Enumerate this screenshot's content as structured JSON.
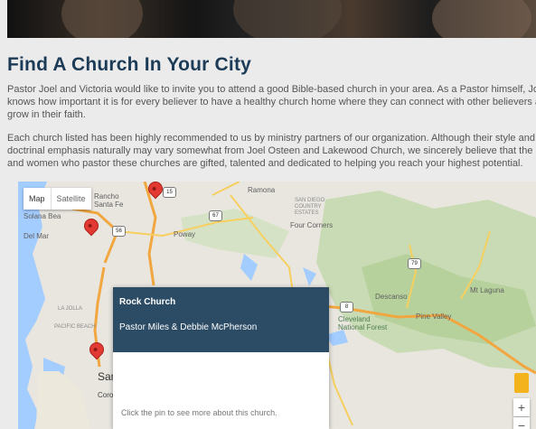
{
  "page": {
    "title": "Find A Church In Your City",
    "paragraph1_lines": [
      "Pastor Joel and Victoria would like to invite you to attend a good Bible-based church in your area. As a Pastor himself, Joel",
      "knows how important it is for every believer to have a healthy church home where they can connect with other believers and",
      "grow in their faith."
    ],
    "paragraph2_lines": [
      "Each church listed has been highly recommended to us by ministry partners of our organization. Although their style and",
      "doctrinal emphasis naturally may vary somewhat from Joel Osteen and Lakewood Church, we sincerely believe that the men",
      "and women who pastor these churches are gifted, talented and dedicated to helping you reach your highest potential."
    ]
  },
  "map": {
    "type_buttons": {
      "map": "Map",
      "satellite": "Satellite"
    },
    "labels": {
      "rancho": "Rancho",
      "santa_fe": "Santa Fe",
      "ramona": "Ramona",
      "solana_beach": "Solana Bea",
      "del_mar": "Del Mar",
      "poway": "Poway",
      "san_diego_country_estates": "SAN DIEGO\nCOUNTRY\nESTATES",
      "four_corners": "Four Corners",
      "la_jolla": "LA JOLLA",
      "pacific_beach": "PACIFIC BEACH",
      "descanso": "Descanso",
      "mt_laguna": "Mt Laguna",
      "cleveland_forest": "Cleveland\nNational Forest",
      "pine_valley": "Pine Valley",
      "san": "San",
      "coro": "Coro"
    },
    "shields": {
      "i15": "15",
      "r56": "56",
      "r67": "67",
      "r79": "79",
      "r8": "8"
    },
    "popup": {
      "church_name": "Rock Church",
      "pastors": "Pastor Miles & Debbie McPherson",
      "note": "Click the pin to see more about this church."
    },
    "zoom": {
      "in": "+",
      "out": "−"
    }
  }
}
